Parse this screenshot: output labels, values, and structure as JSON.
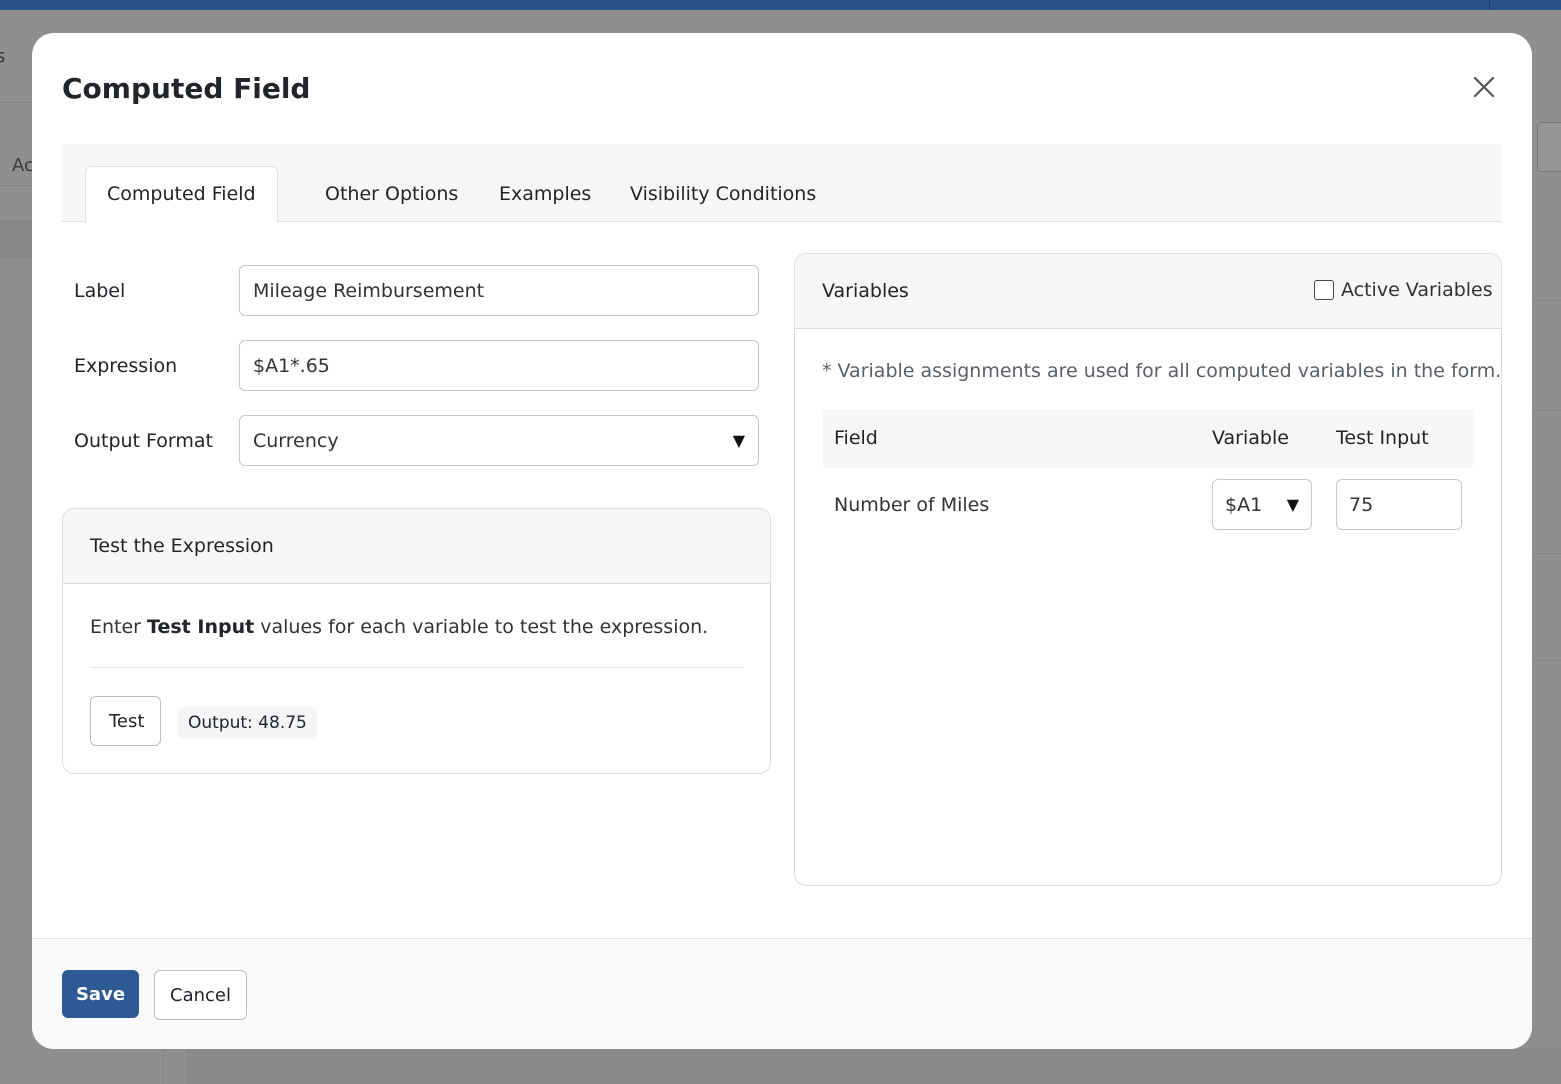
{
  "background": {
    "partial_text_left": "Ac",
    "partial_text_top_left": "s",
    "topbar_color": "#2b5286"
  },
  "modal": {
    "title": "Computed Field",
    "close_icon": "close-icon",
    "tabs": [
      {
        "label": "Computed Field",
        "active": true
      },
      {
        "label": "Other Options",
        "active": false
      },
      {
        "label": "Examples",
        "active": false
      },
      {
        "label": "Visibility Conditions",
        "active": false
      }
    ],
    "form": {
      "label_label": "Label",
      "label_value": "Mileage Reimbursement",
      "expression_label": "Expression",
      "expression_value": "$A1*.65",
      "output_format_label": "Output Format",
      "output_format_value": "Currency"
    },
    "test_card": {
      "title": "Test the Expression",
      "desc_prefix": "Enter",
      "desc_bold": "Test Input",
      "desc_suffix": "values for each variable to test the expression.",
      "test_button": "Test",
      "output_text": "Output: 48.75"
    },
    "variables_card": {
      "title": "Variables",
      "active_variables_label": "Active Variables",
      "active_variables_checked": false,
      "note": "* Variable assignments are used for all computed variables in the form.",
      "columns": [
        "Field",
        "Variable",
        "Test Input"
      ],
      "rows": [
        {
          "field": "Number of Miles",
          "variable": "$A1",
          "test_input": "75"
        }
      ]
    },
    "footer": {
      "save_label": "Save",
      "cancel_label": "Cancel",
      "primary_color": "#2d5a94"
    }
  }
}
